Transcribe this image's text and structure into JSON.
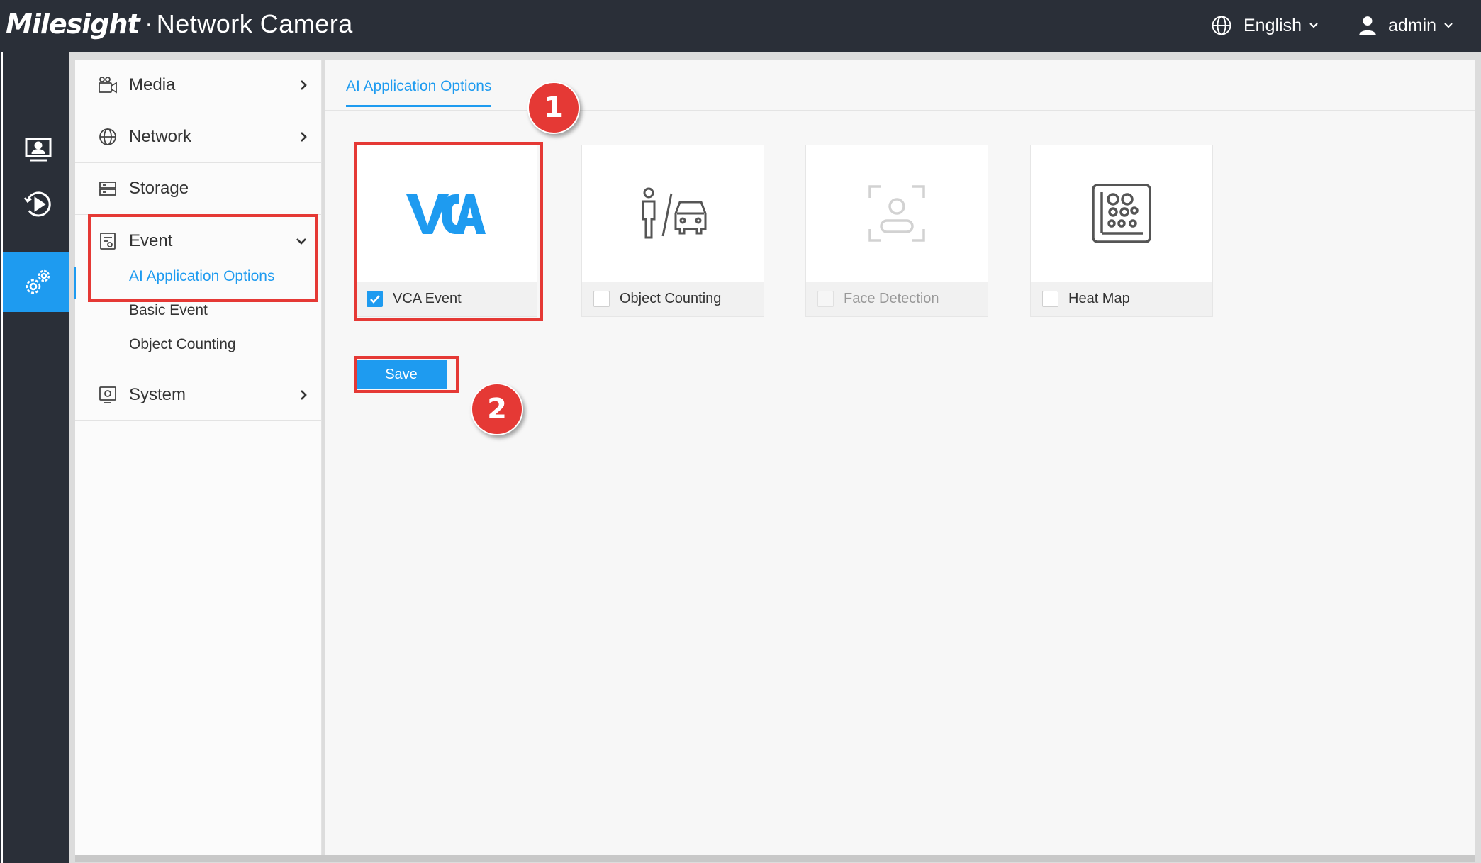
{
  "header": {
    "brand_logo": "Milesight",
    "brand_separator": "·",
    "brand_title": "Network Camera",
    "language": "English",
    "user": "admin"
  },
  "rail": {
    "items": [
      "live-view",
      "playback",
      "settings"
    ],
    "active": "settings"
  },
  "menu": {
    "items": [
      {
        "label": "Media",
        "icon": "camera-icon"
      },
      {
        "label": "Network",
        "icon": "globe-icon"
      },
      {
        "label": "Storage",
        "icon": "storage-icon"
      },
      {
        "label": "Event",
        "icon": "event-icon"
      },
      {
        "label": "System",
        "icon": "system-icon"
      }
    ],
    "event_sub": [
      "AI Application Options",
      "Basic Event",
      "Object Counting"
    ],
    "active_sub": "AI Application Options"
  },
  "content": {
    "tab": "AI Application Options",
    "cards": [
      {
        "label": "VCA Event",
        "checked": true,
        "disabled": false,
        "icon": "vca-logo"
      },
      {
        "label": "Object Counting",
        "checked": false,
        "disabled": false,
        "icon": "person-car-icon"
      },
      {
        "label": "Face Detection",
        "checked": false,
        "disabled": true,
        "icon": "face-detection-icon"
      },
      {
        "label": "Heat Map",
        "checked": false,
        "disabled": false,
        "icon": "heat-map-icon"
      }
    ],
    "save_label": "Save"
  },
  "annotations": {
    "step1": "1",
    "step2": "2"
  },
  "colors": {
    "accent": "#1e9bf0",
    "header_bg": "#2a2f38",
    "highlight": "#e53935"
  }
}
